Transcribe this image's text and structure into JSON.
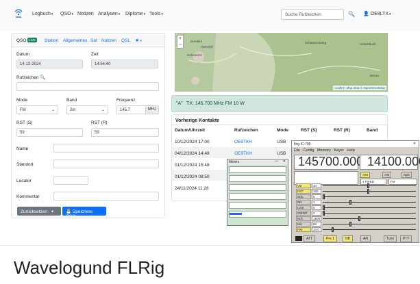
{
  "nav": {
    "menu": [
      "Logbuch",
      "QSO",
      "Notizen",
      "Analysen",
      "Diplome",
      "Tools"
    ],
    "search_placeholder": "Suche Rufzeichen",
    "user": "OE9LTX"
  },
  "qso_card": {
    "tabs": [
      "QSO",
      "LIVE",
      "Station",
      "Allgemeines",
      "Sat",
      "Notizen",
      "QSL"
    ],
    "datum_label": "Datum",
    "datum_value": "14-12-2024",
    "zeit_label": "Zeit",
    "zeit_value": "14:54:40",
    "rufzeichen_label": "Rufzeichen",
    "mode_label": "Mode",
    "mode_value": "FM",
    "band_label": "Band",
    "band_value": "2m",
    "frequenz_label": "Frequenz",
    "frequenz_value": "145.7",
    "frequenz_unit": "MHz",
    "rst_s_label": "RST (S)",
    "rst_s_value": "59",
    "rst_r_label": "RST (R)",
    "rst_r_value": "59",
    "name_label": "Name",
    "standort_label": "Standort",
    "locator_label": "Locator",
    "kommentar_label": "Kommentar",
    "reset_button": "Zurücksetzen",
    "save_button": "Speichere QSO"
  },
  "map": {
    "attribution": "Leaflet | Map data © OpenStreetMap",
    "places": [
      "Dornbirn",
      "Oberdorf",
      "Hohenems",
      "Schwarzenberg",
      "Andelsbuch",
      "Bezau"
    ],
    "zoom_in": "+",
    "zoom_out": "−"
  },
  "tx_status": "TX: 145.700 MHz  FM  10 W",
  "contacts": {
    "title": "Vorherige Kontakte",
    "headers": [
      "Datum/Uhrzeit",
      "Rufzeichen",
      "Mode",
      "RST (S)",
      "RST (R)",
      "Band"
    ],
    "rows": [
      [
        "10/12/2024 17:00",
        "OE9TKH",
        "USB"
      ],
      [
        "04/12/2024 14:48",
        "OE9TKH",
        "USB"
      ],
      [
        "01/12/2024 15:48",
        "",
        ""
      ],
      [
        "01/12/2024 08:50",
        "",
        ""
      ],
      [
        "24/11/2024 11:28",
        "",
        ""
      ]
    ]
  },
  "flrig": {
    "title": "flrig IC-705",
    "menu": [
      "File",
      "Config",
      "Memory",
      "Keyer",
      "Help"
    ],
    "freq_a": "145700.000",
    "freq_b": "14100.000",
    "mode": "FM",
    "filter": "1 FIXED",
    "controls": [
      "Vol",
      "FST",
      "SQL",
      "NR",
      "Lock",
      "OtrPBT",
      "Nch",
      "Mic",
      "Pwr"
    ],
    "control_values": [
      "34",
      "100",
      "0",
      "4",
      "0",
      "0",
      "1500",
      "50",
      "10.0"
    ],
    "buttons": [
      "ATT",
      "Pre 1",
      "NB",
      "AN",
      "Tune",
      "PTT"
    ],
    "ab_buttons": [
      "A/M",
      "A/B",
      "Split"
    ]
  },
  "meters_window": {
    "title": "Meters"
  },
  "caption": "Wavelogund FLRig"
}
